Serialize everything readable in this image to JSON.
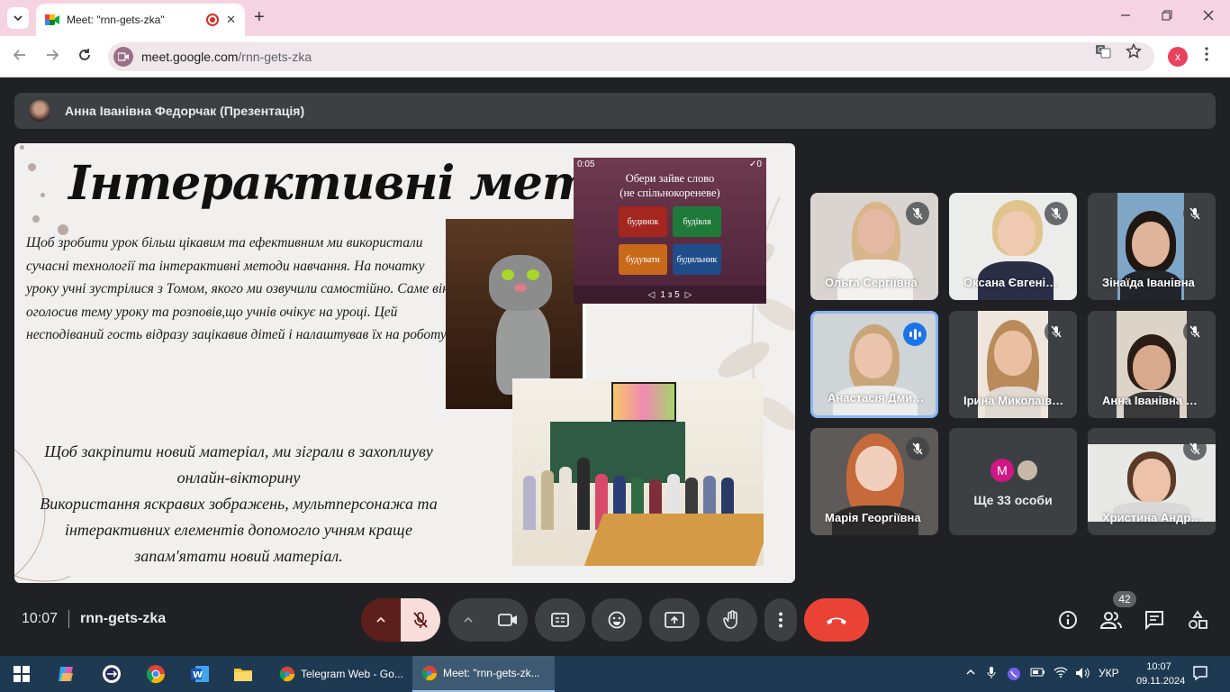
{
  "browser": {
    "tab_title": "Meet: \"rnn-gets-zka\"",
    "url_host": "meet.google.com",
    "url_path": "/rnn-gets-zka",
    "profile_initial": "x"
  },
  "presenter": {
    "name": "Анна Іванівна Федорчак (Презентація)"
  },
  "slide": {
    "title": "Інтерактивні методи",
    "paragraph1": "Щоб зробити урок більш цікавим та ефективним ми використали сучасні технології та інтерактивні методи навчання. На початку уроку учні зустрілися з Томом, якого ми озвучили самостійно. Саме він оголосив тему уроку та розповів,що учнів очікує на уроці. Цей несподіваний гость відразу зацікавив дітей і налаштував їх на роботу.",
    "paragraph2_line1": "Щоб закріпити новий матеріал, ми зіграли в захоплиуву онлайн-вікторину",
    "paragraph2_line2": "Використання яскравих зображень, мультперсонажа та інтерактивних елементів допомогло учням краще запам'ятати новий матеріал.",
    "quiz": {
      "time": "0:05",
      "score": "✓0",
      "question_line1": "Обери зайве слово",
      "question_line2": "(не спільнокореневе)",
      "options": [
        "будинок",
        "будівля",
        "будувати",
        "будильник"
      ],
      "pager": "1 з 5"
    }
  },
  "participants": [
    {
      "name": "Ольга Сергіївна",
      "muted": true
    },
    {
      "name": "Оксана Євгенівна",
      "muted": true
    },
    {
      "name": "Зінаїда Іванівна",
      "muted": true
    },
    {
      "name": "Анастасія Дмитрівна",
      "muted": false,
      "speaking": true
    },
    {
      "name": "Ірина Миколаївна",
      "muted": true
    },
    {
      "name": "Анна Іванівна Федорчак",
      "muted": true
    },
    {
      "name": "Марія Георгіївна",
      "muted": true
    },
    {
      "name": "Христина Андріївна",
      "muted": true
    }
  ],
  "more_tile": {
    "label": "Ще 33 особи",
    "avatar_initial": "M"
  },
  "controls": {
    "time": "10:07",
    "meeting_code": "rnn-gets-zka",
    "people_count": "42"
  },
  "taskbar": {
    "apps": [
      "Telegram Web - Go...",
      "Meet: \"rnn-gets-zk..."
    ],
    "language": "УКР",
    "time": "10:07",
    "date": "09.11.2024"
  },
  "colors": {
    "meet_bg": "#202124",
    "tile_bg": "#3c4043",
    "leave_red": "#ea4335",
    "speaking_blue": "#1a73e8",
    "tab_strip": "#f6d3e1",
    "taskbar": "#1e3a52"
  }
}
